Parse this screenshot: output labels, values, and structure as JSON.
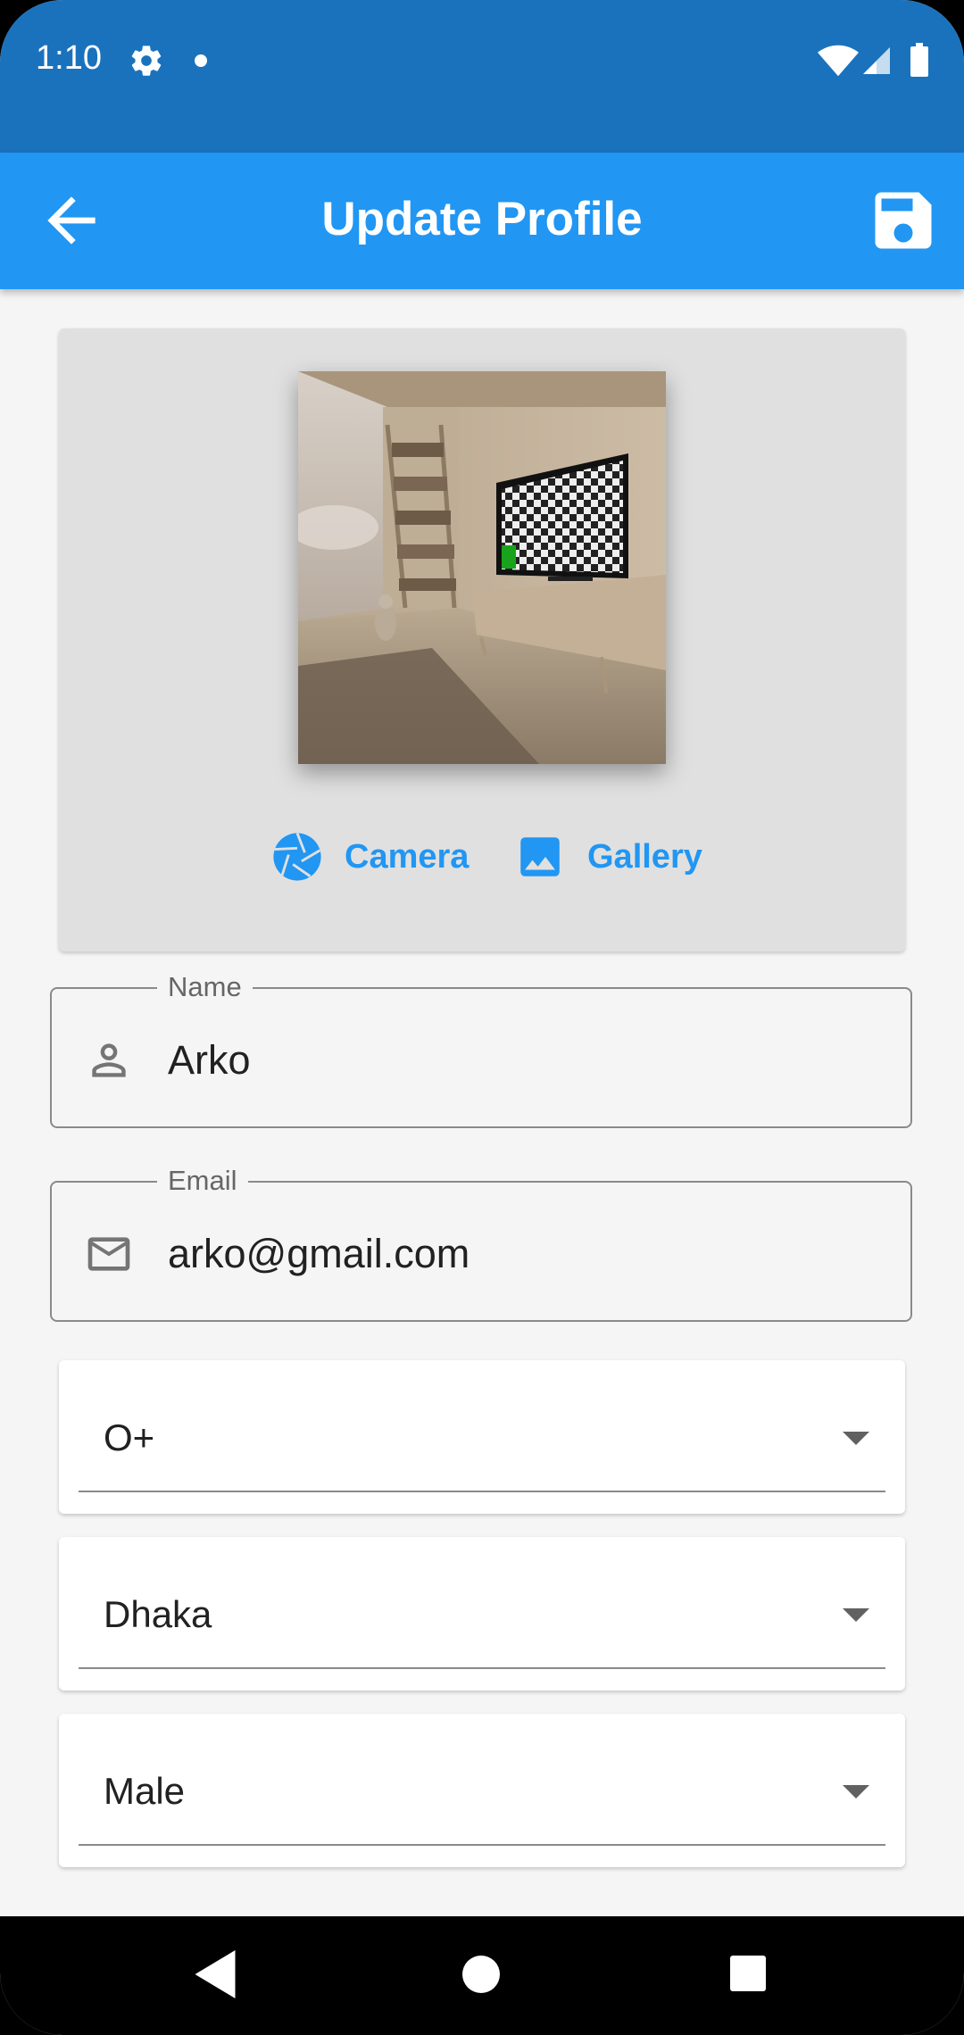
{
  "status_bar": {
    "time": "1:10",
    "icons": [
      "gear-icon",
      "notification-dot",
      "wifi-icon",
      "signal-icon",
      "battery-icon"
    ]
  },
  "app_bar": {
    "title": "Update Profile",
    "back_icon": "arrow-back-icon",
    "save_icon": "save-icon",
    "color": "#2196f3"
  },
  "image_picker": {
    "photo_alt": "Room with TV and bookshelf",
    "camera_label": "Camera",
    "gallery_label": "Gallery",
    "accent": "#2196f3"
  },
  "form": {
    "name": {
      "label": "Name",
      "value": "Arko",
      "icon": "person-icon"
    },
    "email": {
      "label": "Email",
      "value": "arko@gmail.com",
      "icon": "mail-icon"
    },
    "blood_group": {
      "value": "O+"
    },
    "city": {
      "value": "Dhaka"
    },
    "gender": {
      "value": "Male"
    }
  },
  "nav_bar": {
    "icons": [
      "nav-back-icon",
      "nav-home-icon",
      "nav-recents-icon"
    ]
  }
}
